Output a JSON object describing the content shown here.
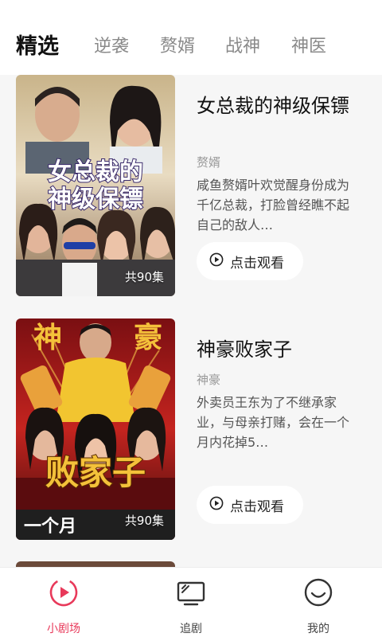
{
  "tabs": [
    {
      "label": "精选",
      "active": true
    },
    {
      "label": "逆袭"
    },
    {
      "label": "赘婿"
    },
    {
      "label": "战神"
    },
    {
      "label": "神医"
    }
  ],
  "dramas": [
    {
      "poster_text": "女总裁的神级保镖",
      "episode_count": "共90集",
      "title": "女总裁的神级保镖",
      "tag": "赘婿",
      "description": "咸鱼赘婿叶欢觉醒身份成为千亿总裁，打脸曾经瞧不起自己的敌人…",
      "watch_label": "点击观看"
    },
    {
      "poster_text": "败家子",
      "poster_text_top": "神豪",
      "poster_text_bottom": "一个月",
      "episode_count": "共90集",
      "title": "神豪败家子",
      "tag": "神豪",
      "description": "外卖员王东为了不继承家业，与母亲打赌，会在一个月内花掉5…",
      "watch_label": "点击观看"
    }
  ],
  "bottom_nav": [
    {
      "label": "小剧场",
      "icon": "play-circle-icon",
      "active": true
    },
    {
      "label": "追剧",
      "icon": "tv-icon"
    },
    {
      "label": "我的",
      "icon": "smile-face-icon"
    }
  ],
  "colors": {
    "accent": "#e8395a",
    "background": "#f6f6f6"
  }
}
